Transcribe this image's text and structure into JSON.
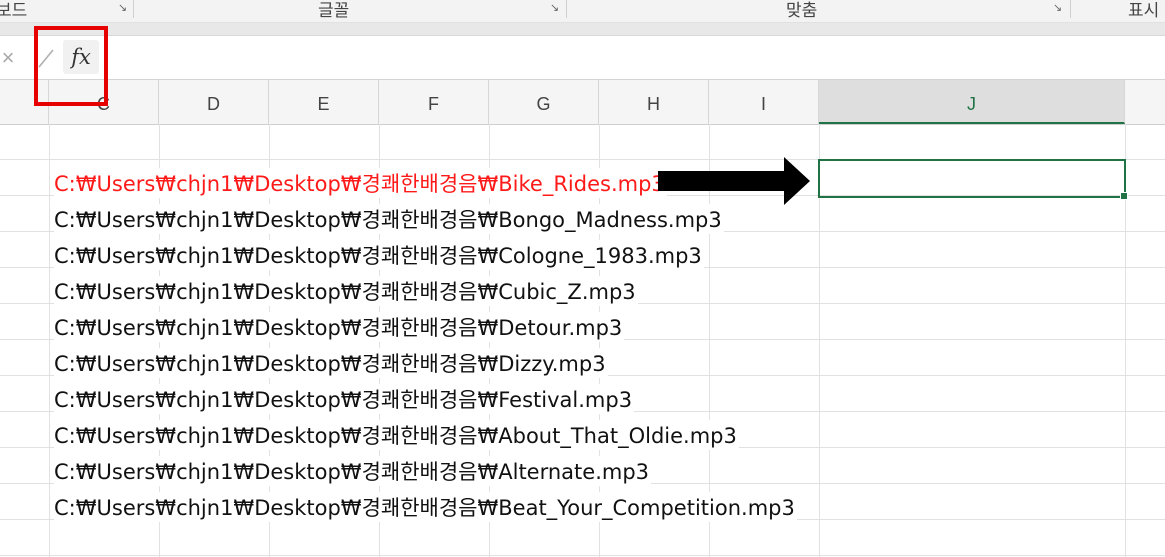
{
  "ribbon": {
    "groups": [
      {
        "label": "보드"
      },
      {
        "label": "글꼴"
      },
      {
        "label": "맞춤"
      },
      {
        "label": "표시"
      }
    ],
    "launcher_icon": "dialog-launcher-icon"
  },
  "formula_bar": {
    "cancel_icon": "×",
    "enter_icon": "✓",
    "fx_label": "fx",
    "value": ""
  },
  "columns": [
    "C",
    "D",
    "E",
    "F",
    "G",
    "H",
    "I",
    "J"
  ],
  "selected_column": "J",
  "rows": [
    {
      "text": "",
      "red": false
    },
    {
      "text": "C:₩Users₩chjn1₩Desktop₩경쾌한배경음₩Bike_Rides.mp3",
      "red": true
    },
    {
      "text": "C:₩Users₩chjn1₩Desktop₩경쾌한배경음₩Bongo_Madness.mp3",
      "red": false
    },
    {
      "text": "C:₩Users₩chjn1₩Desktop₩경쾌한배경음₩Cologne_1983.mp3",
      "red": false
    },
    {
      "text": "C:₩Users₩chjn1₩Desktop₩경쾌한배경음₩Cubic_Z.mp3",
      "red": false
    },
    {
      "text": "C:₩Users₩chjn1₩Desktop₩경쾌한배경음₩Detour.mp3",
      "red": false
    },
    {
      "text": "C:₩Users₩chjn1₩Desktop₩경쾌한배경음₩Dizzy.mp3",
      "red": false
    },
    {
      "text": "C:₩Users₩chjn1₩Desktop₩경쾌한배경음₩Festival.mp3",
      "red": false
    },
    {
      "text": "C:₩Users₩chjn1₩Desktop₩경쾌한배경음₩About_That_Oldie.mp3",
      "red": false
    },
    {
      "text": "C:₩Users₩chjn1₩Desktop₩경쾌한배경음₩Alternate.mp3",
      "red": false
    },
    {
      "text": "C:₩Users₩chjn1₩Desktop₩경쾌한배경음₩Beat_Your_Competition.mp3",
      "red": false
    }
  ],
  "active_cell": {
    "column": "J",
    "value": ""
  },
  "colors": {
    "accent_green": "#217346",
    "highlight_red": "#e60000",
    "text_red": "#ff1a1a"
  },
  "annotations": {
    "highlight_box": "red rectangle around fx button",
    "arrow": "black arrow pointing to active cell"
  }
}
